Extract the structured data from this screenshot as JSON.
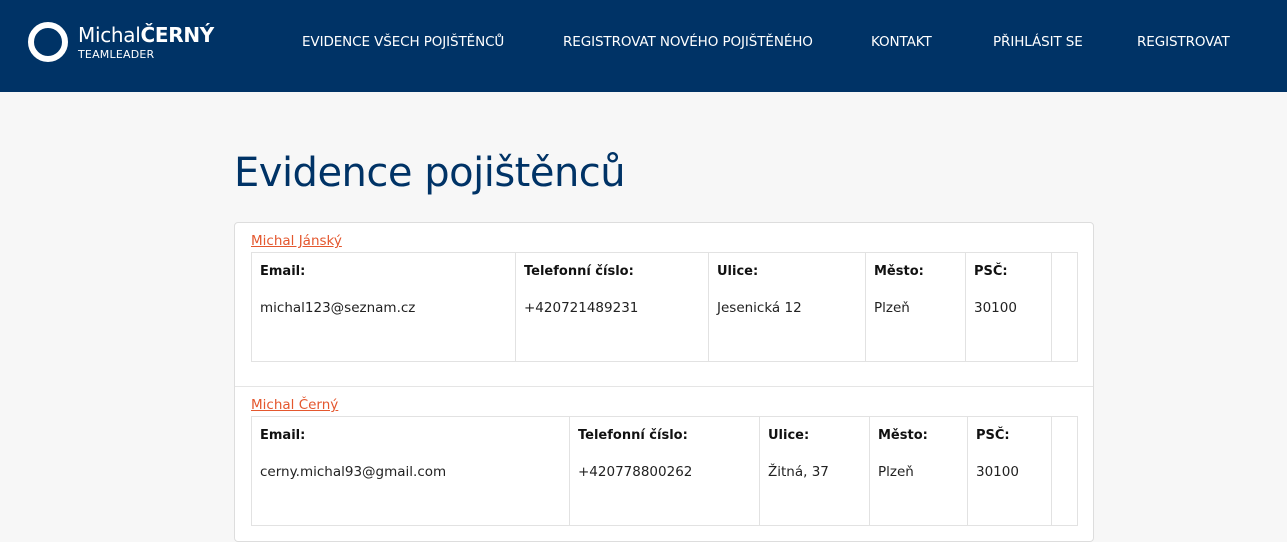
{
  "brand": {
    "first_name": "Michal",
    "last_name": "ČERNÝ",
    "role": "TEAMLEADER"
  },
  "nav": {
    "items": [
      {
        "label": "EVIDENCE VŠECH POJIŠTĚNCŮ"
      },
      {
        "label": "REGISTROVAT NOVÉHO POJIŠTĚNÉHO"
      },
      {
        "label": "KONTAKT"
      },
      {
        "label": "PŘIHLÁSIT SE"
      },
      {
        "label": "REGISTROVAT"
      }
    ]
  },
  "page": {
    "title": "Evidence pojištěnců"
  },
  "columns": {
    "email": "Email:",
    "phone": "Telefonní číslo:",
    "street": "Ulice:",
    "city": "Město:",
    "zip": "PSČ:"
  },
  "people": [
    {
      "name": "Michal Jánský",
      "email": "michal123@seznam.cz",
      "phone": "+420721489231",
      "street": "Jesenická 12",
      "city": "Plzeň",
      "zip": "30100"
    },
    {
      "name": "Michal Černý",
      "email": "cerny.michal93@gmail.com",
      "phone": "+420778800262",
      "street": "Žitná, 37",
      "city": "Plzeň",
      "zip": "30100"
    }
  ],
  "colors": {
    "header_bg": "#003366",
    "title": "#003366",
    "link": "#e4572e",
    "page_bg": "#f7f7f7"
  }
}
